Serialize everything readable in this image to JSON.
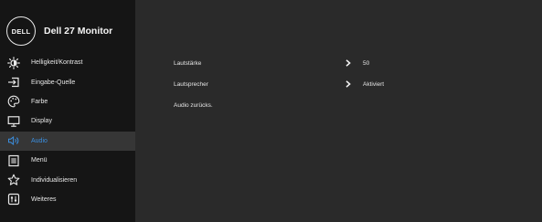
{
  "header": {
    "logo_text": "DELL",
    "model": "Dell 27 Monitor"
  },
  "menu": {
    "items": [
      {
        "label": "Helligkeit/Kontrast",
        "icon": "brightness-icon"
      },
      {
        "label": "Eingabe-Quelle",
        "icon": "input-source-icon"
      },
      {
        "label": "Farbe",
        "icon": "color-palette-icon"
      },
      {
        "label": "Display",
        "icon": "display-icon"
      },
      {
        "label": "Audio",
        "icon": "speaker-icon",
        "active": true
      },
      {
        "label": "Menü",
        "icon": "menu-icon"
      },
      {
        "label": "Individualisieren",
        "icon": "star-icon"
      },
      {
        "label": "Weiteres",
        "icon": "settings-icon"
      }
    ]
  },
  "content": {
    "volume_label": "Lautstärke",
    "volume_value": "50",
    "speaker_label": "Lautsprecher",
    "speaker_value": "Aktiviert",
    "reset_label": "Audio zurücks."
  },
  "colors": {
    "panel_bg": "#2a2a2a",
    "sidebar_bg": "#151515",
    "active_bg": "#363636",
    "accent": "#3b8fe0",
    "text": "#e6e6e6"
  }
}
